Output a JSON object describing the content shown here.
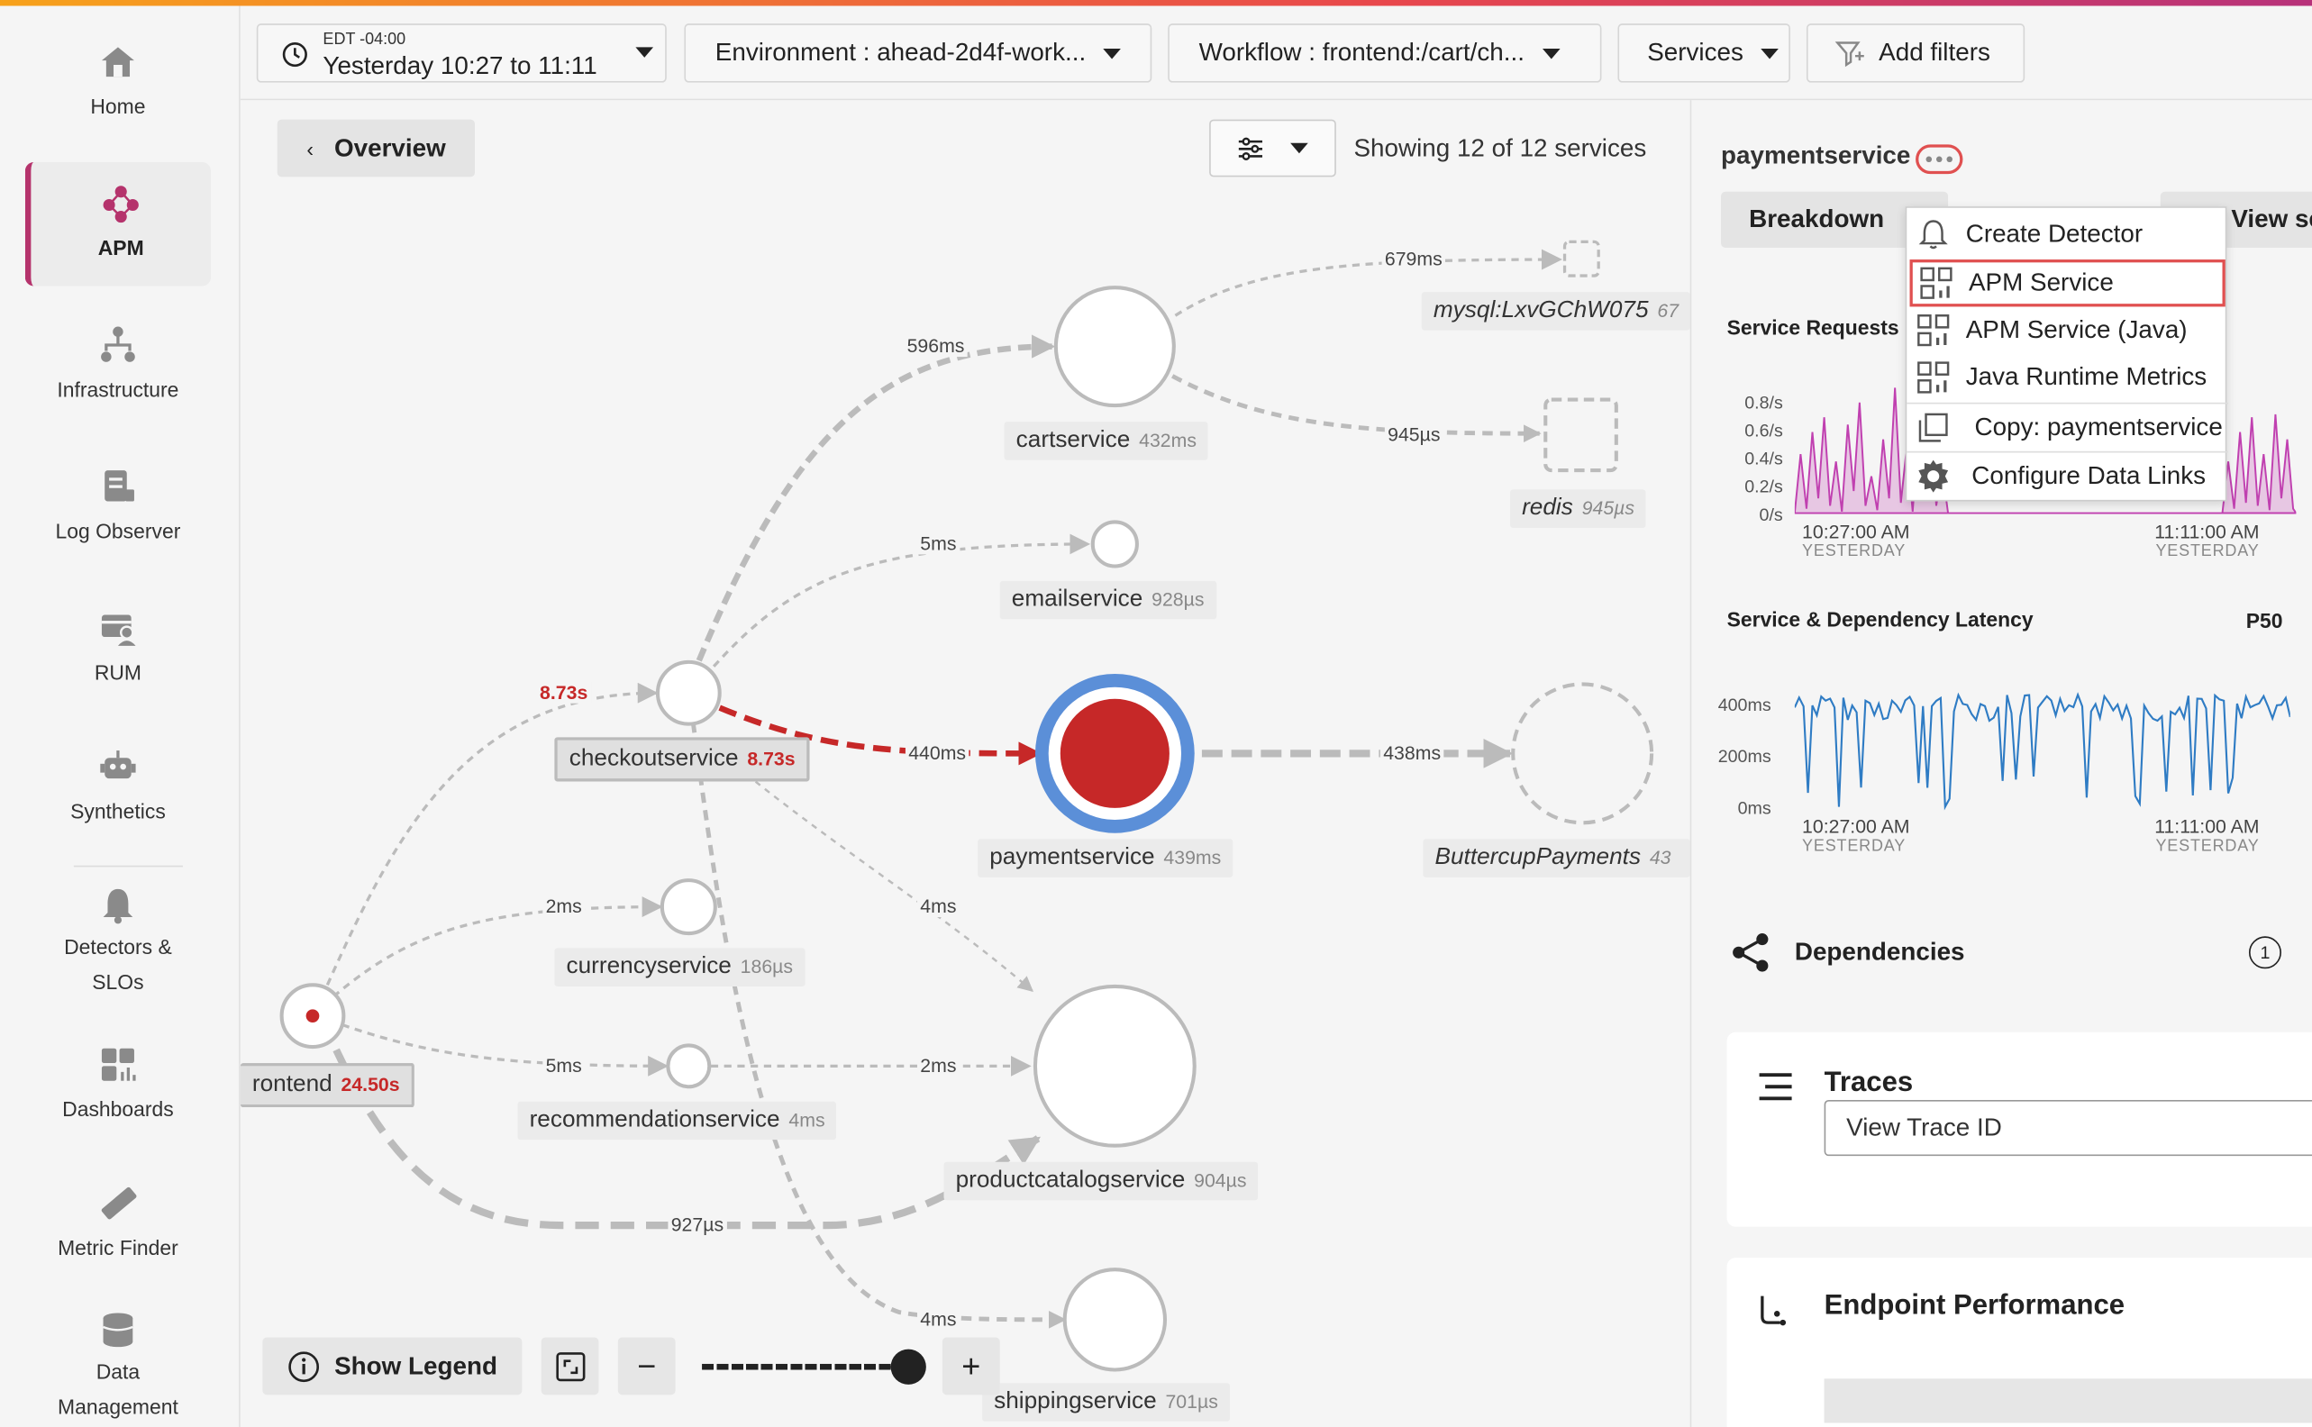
{
  "nav": {
    "items": [
      {
        "label": "Home",
        "icon": "home-icon"
      },
      {
        "label": "APM",
        "icon": "apm-icon"
      },
      {
        "label": "Infrastructure",
        "icon": "infrastructure-icon"
      },
      {
        "label": "Log Observer",
        "icon": "log-icon"
      },
      {
        "label": "RUM",
        "icon": "rum-icon"
      },
      {
        "label": "Synthetics",
        "icon": "robot-icon"
      },
      {
        "label": "Detectors &",
        "label2": "SLOs",
        "icon": "bell-icon"
      },
      {
        "label": "Dashboards",
        "icon": "dashboard-icon"
      },
      {
        "label": "Metric Finder",
        "icon": "ruler-icon"
      },
      {
        "label": "Data",
        "label2": "Management",
        "icon": "database-icon"
      }
    ]
  },
  "filters": {
    "timezone": "EDT -04:00",
    "time_range": "Yesterday 10:27 to 11:11",
    "environment": "Environment : ahead-2d4f-work...",
    "workflow": "Workflow : frontend:/cart/ch...",
    "services": "Services",
    "add_filters": "Add filters"
  },
  "map": {
    "overview": "Overview",
    "showing": "Showing 12 of 12 services",
    "show_legend": "Show Legend",
    "nodes": {
      "frontend": {
        "name": "rontend",
        "latency": "24.50s"
      },
      "checkout": {
        "name": "checkoutservice",
        "latency": "8.73s"
      },
      "cart": {
        "name": "cartservice",
        "latency": "432ms"
      },
      "email": {
        "name": "emailservice",
        "latency": "928µs"
      },
      "payment": {
        "name": "paymentservice",
        "latency": "439ms"
      },
      "currency": {
        "name": "currencyservice",
        "latency": "186µs"
      },
      "recommendation": {
        "name": "recommendationservice",
        "latency": "4ms"
      },
      "productcatalog": {
        "name": "productcatalogservice",
        "latency": "904µs"
      },
      "shipping": {
        "name": "shippingservice",
        "latency": "701µs"
      },
      "mysql": {
        "name": "mysql:LxvGChW075",
        "latency": "67"
      },
      "redis": {
        "name": "redis",
        "latency": "945µs"
      },
      "buttercup": {
        "name": "ButtercupPayments",
        "latency": "43"
      }
    },
    "edges": {
      "front_checkout": "8.73s",
      "checkout_cart": "596ms",
      "cart_mysql": "679ms",
      "cart_redis": "945µs",
      "checkout_email": "5ms",
      "checkout_payment": "440ms",
      "payment_buttercup": "438ms",
      "checkout_product": "4ms",
      "front_currency": "2ms",
      "front_recommend": "5ms",
      "recommend_product": "2ms",
      "front_product": "927µs",
      "checkout_shipping": "4ms"
    }
  },
  "panel": {
    "title": "paymentservice",
    "breakdown": "Breakdown",
    "view_se": "View se",
    "requests_title": "Service Requests",
    "requests_yticks": [
      "0.8/s",
      "0.6/s",
      "0.4/s",
      "0.2/s",
      "0/s"
    ],
    "latency_title": "Service & Dependency Latency",
    "latency_p": "P50",
    "latency_yticks": [
      "400ms",
      "200ms",
      "0ms"
    ],
    "x_start": "10:27:00 AM",
    "x_end": "11:11:00 AM",
    "x_sub": "YESTERDAY",
    "dependencies": "Dependencies",
    "dependencies_count": "1",
    "traces": "Traces",
    "trace_placeholder": "View Trace ID",
    "endpoint": "Endpoint Performance",
    "colors": {
      "requests": "#c040b0",
      "latency": "#2f7cc4"
    }
  },
  "dropdown": {
    "items": [
      "Create Detector",
      "APM Service",
      "APM Service (Java)",
      "Java Runtime Metrics",
      "Copy: paymentservice",
      "Configure Data Links"
    ]
  }
}
